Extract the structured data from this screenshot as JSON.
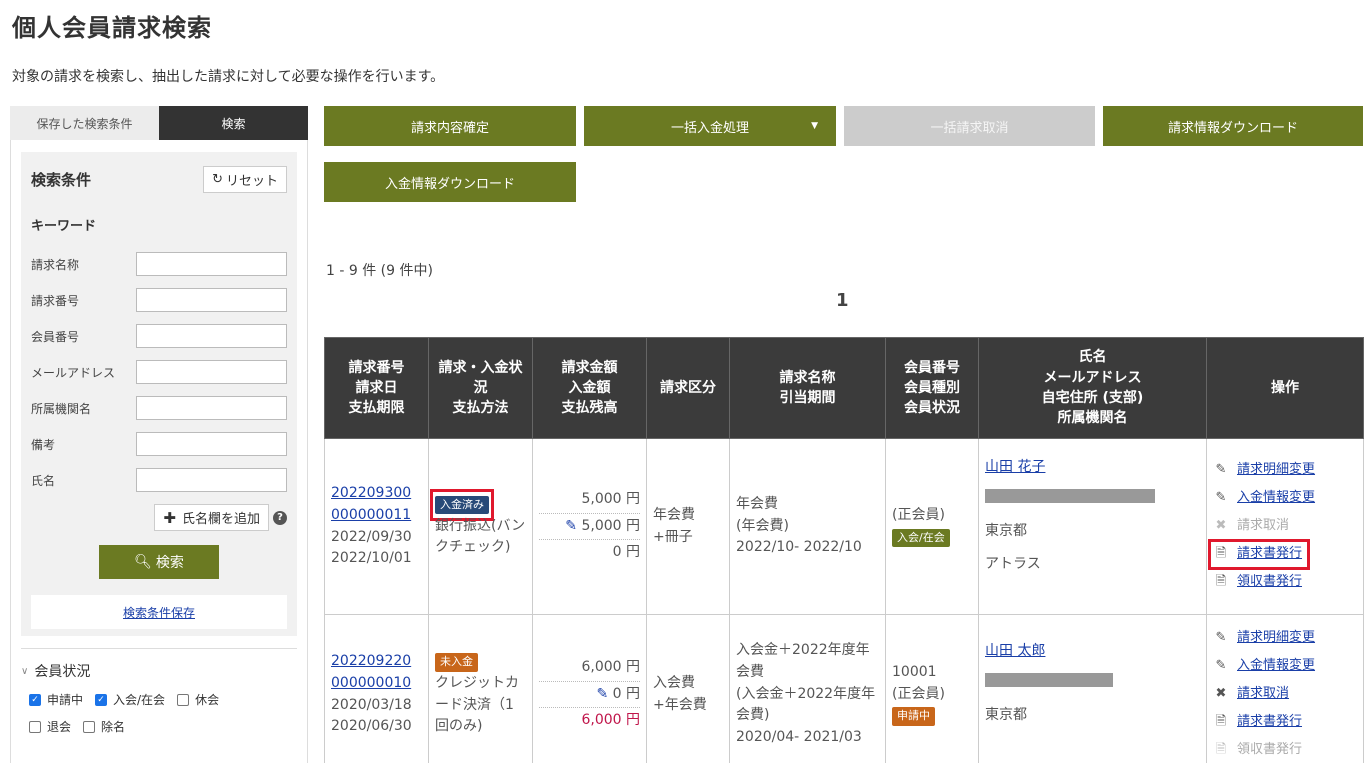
{
  "page": {
    "title": "個人会員請求検索",
    "description": "対象の請求を検索し、抽出した請求に対して必要な操作を行います。"
  },
  "left": {
    "tabs": [
      "保存した検索条件",
      "検索"
    ],
    "cond_title": "検索条件",
    "reset_label": "リセット",
    "keyword_title": "キーワード",
    "fields": [
      "請求名称",
      "請求番号",
      "会員番号",
      "メールアドレス",
      "所属機関名",
      "備考",
      "氏名"
    ],
    "add_name_label": "氏名欄を追加",
    "search_label": "検索",
    "save_cond_label": "検索条件保存",
    "member_status_title": "会員状況",
    "statuses": [
      {
        "label": "申請中",
        "checked": true
      },
      {
        "label": "入会/在会",
        "checked": true
      },
      {
        "label": "休会",
        "checked": false
      },
      {
        "label": "退会",
        "checked": false
      },
      {
        "label": "除名",
        "checked": false
      }
    ]
  },
  "toolbar": {
    "confirm": "請求内容確定",
    "bulk_payment": "一括入金処理",
    "bulk_cancel": "一括請求取消",
    "bill_download": "請求情報ダウンロード",
    "payment_download": "入金情報ダウンロード"
  },
  "results": {
    "count": "1 - 9 件 (9 件中)",
    "page": "1",
    "headers": [
      "請求番号\n請求日\n支払期限",
      "請求・入金状況\n支払方法",
      "請求金額\n入金額\n支払残高",
      "請求区分",
      "請求名称\n引当期間",
      "会員番号\n会員種別\n会員状況",
      "氏名\nメールアドレス\n自宅住所 (支部)\n所属機関名",
      "操作"
    ],
    "rows": [
      {
        "bill_no_1": "202209300",
        "bill_no_2": "000000011",
        "bill_date": "2022/09/30",
        "due_date": "2022/10/01",
        "status_badge": "入金済み",
        "method": "銀行振込(バンクチェック)",
        "amount": "5,000 円",
        "paid": "5,000 円",
        "remaining": "0 円",
        "category": "年会費\n+冊子",
        "name_l1": "年会費",
        "name_l2": "(年会費)",
        "period": "2022/10- 2022/10",
        "member_no": "",
        "member_type": "(正会員)",
        "member_status": "入会/在会",
        "person": "山田 花子",
        "address": "東京都",
        "org": "アトラス",
        "ops": [
          "請求明細変更",
          "入金情報変更",
          "請求取消",
          "請求書発行",
          "領収書発行"
        ]
      },
      {
        "bill_no_1": "202209220",
        "bill_no_2": "000000010",
        "bill_date": "2020/03/18",
        "due_date": "2020/06/30",
        "status_badge": "未入金",
        "method": "クレジットカード決済（1回のみ)",
        "amount": "6,000 円",
        "paid": "0 円",
        "remaining": "6,000 円",
        "category": "入会費\n+年会費",
        "name_l1": "入会金＋2022年度年会費",
        "name_l2": "(入会金＋2022年度年会費)",
        "period": "2020/04- 2021/03",
        "member_no": "10001",
        "member_type": "(正会員)",
        "member_status": "申請中",
        "person": "山田 太郎",
        "address": "東京都",
        "org": "",
        "ops": [
          "請求明細変更",
          "入金情報変更",
          "請求取消",
          "請求書発行",
          "領収書発行"
        ]
      }
    ]
  }
}
